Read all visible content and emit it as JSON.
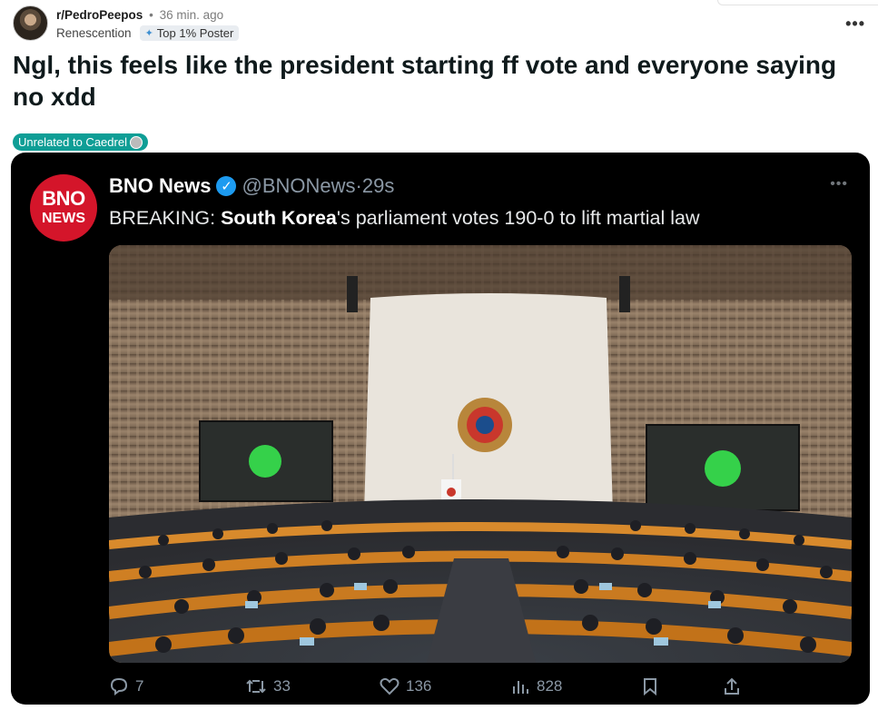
{
  "post": {
    "subreddit": "r/PedroPeepos",
    "separator": "•",
    "time": "36 min. ago",
    "author": "Renescention",
    "author_flair": "Top 1% Poster",
    "more": "•••",
    "title": "Ngl, this feels like the president starting ff vote and everyone saying no xdd",
    "post_flair": "Unrelated to Caedrel"
  },
  "tweet": {
    "logo_line1": "BNO",
    "logo_line2": "NEWS",
    "name": "BNO News",
    "handle": "@BNONews",
    "separator": "·",
    "time": "29s",
    "more": "•••",
    "text_prefix": "BREAKING: ",
    "text_bold": "South Korea",
    "text_suffix": "'s parliament votes 190-0 to lift martial law",
    "actions": {
      "replies": "7",
      "retweets": "33",
      "likes": "136",
      "views": "828"
    }
  },
  "colors": {
    "accent_flair": "#0f9e96",
    "verified": "#1d9bf0",
    "bno_red": "#d4152a"
  }
}
